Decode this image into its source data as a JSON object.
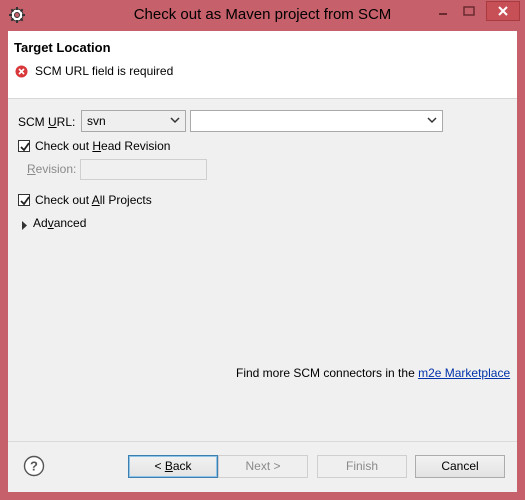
{
  "window": {
    "title": "Check out as Maven project from SCM"
  },
  "header": {
    "title": "Target Location",
    "error_message": "SCM URL field is required"
  },
  "form": {
    "scm_url_label_pre": "SCM ",
    "scm_url_label_u": "U",
    "scm_url_label_post": "RL:",
    "scm_type_value": "svn",
    "scm_url_value": "",
    "head_revision": {
      "pre": "Check out ",
      "u": "H",
      "post": "ead Revision",
      "checked": true
    },
    "revision_label_pre": "",
    "revision_label_u": "R",
    "revision_label_post": "evision:",
    "revision_value": "",
    "all_projects": {
      "pre": "Check out ",
      "u": "A",
      "post": "ll Projects",
      "checked": true
    },
    "advanced": {
      "pre": "Ad",
      "u": "v",
      "post": "anced",
      "expanded": false
    }
  },
  "marketplace": {
    "text": "Find more SCM connectors in the ",
    "link": "m2e Marketplace"
  },
  "buttons": {
    "back": "< Back",
    "back_u": "B",
    "next": "Next >",
    "finish": "Finish",
    "cancel": "Cancel"
  },
  "colors": {
    "title_bar": "#c6606a",
    "link": "#0033aa",
    "error": "#d9383a"
  },
  "icons": [
    "eclipse-gear-icon",
    "minimize-icon",
    "maximize-icon",
    "close-icon",
    "error-icon",
    "chevron-down-icon",
    "checkmark-icon",
    "expand-triangle-icon",
    "help-icon"
  ]
}
